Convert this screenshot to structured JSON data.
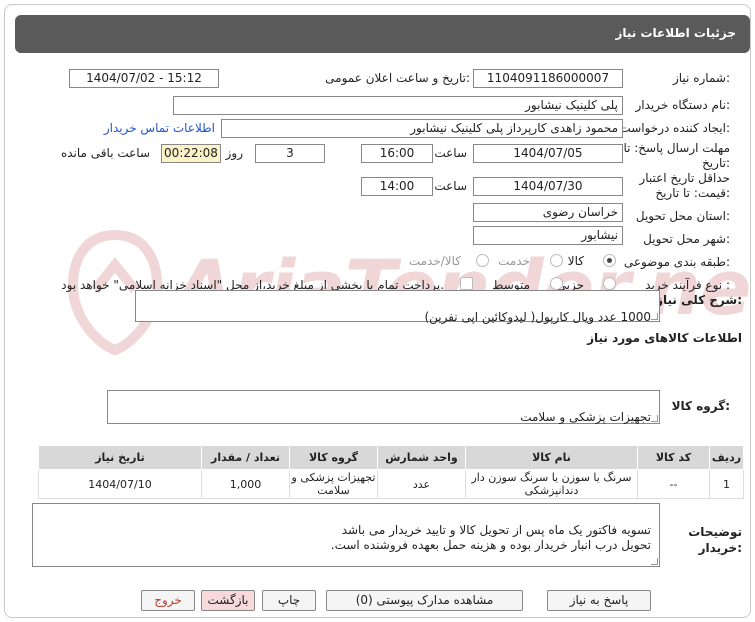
{
  "header": {
    "title": "جزئیات اطلاعات نیاز"
  },
  "fields": {
    "need_number_label": "شماره نیاز:",
    "need_number": "1104091186000007",
    "announce_label": "تاریخ و ساعت اعلان عمومی:",
    "announce_value": "1404/07/02 - 15:12",
    "buyer_org_label": "نام دستگاه خریدار:",
    "buyer_org": "پلی کلینیک نیشابور",
    "creator_label": "ایجاد کننده درخواست:",
    "creator": "محمود زاهدی کارپرداز پلی کلینیک نیشابور",
    "contact_link": "اطلاعات تماس خریدار",
    "deadline_label": "مهلت ارسال پاسخ: تا تاریخ:",
    "deadline_date": "1404/07/05",
    "time_label": "ساعت",
    "deadline_time": "16:00",
    "days_value": "3",
    "days_label": "روز و",
    "remaining_time": "00:22:08",
    "remaining_label": "ساعت باقی مانده",
    "price_validity_label": "حداقل تاریخ اعتبار قیمت: تا تاریخ:",
    "validity_date": "1404/07/30",
    "validity_time": "14:00",
    "province_label": "استان محل تحویل:",
    "province": "خراسان رضوی",
    "city_label": "شهر محل تحویل:",
    "city": "نیشابور",
    "category_label": "طبقه بندی موضوعی:",
    "category_options": [
      "کالا",
      "خدمت",
      "کالا/خدمت"
    ],
    "process_label": "نوع فرآیند خرید :",
    "process_options": [
      "جزیی",
      "متوسط"
    ],
    "treasury_note": "پرداخت تمام یا بخشی از مبلغ خرید،از محل \"اسناد خزانه اسلامی\" خواهد بود.",
    "summary_label": "شرح کلی نیاز:",
    "summary": "1000 عدد ویال کارپول( لیدوکائین اپی نفرین)",
    "goods_info_label": "اطلاعات کالاهای مورد نیاز",
    "goods_group_label": "گروه کالا:",
    "goods_group": "تجهیزات پزشکی و سلامت",
    "buyer_notes_label": "توضیحات خریدار:",
    "buyer_notes": "تسویه فاکتور یک ماه پس از تحویل کالا و تایید خریدار می باشد\nتحویل درب انبار خریدار بوده و هزینه حمل بعهده فروشنده است."
  },
  "table": {
    "headers": [
      "ردیف",
      "کد کالا",
      "نام کالا",
      "واحد شمارش",
      "گروه کالا",
      "تعداد / مقدار",
      "تاریخ نیاز"
    ],
    "rows": [
      [
        "1",
        "--",
        "سرنگ یا سوزن یا سرنگ سوزن دار دندانپزشکی",
        "عدد",
        "تجهیزات پزشکی و سلامت",
        "1,000",
        "1404/07/10"
      ]
    ]
  },
  "buttons": {
    "reply": "پاسخ به نیاز",
    "attachments": "مشاهده مدارک پیوستی (0)",
    "print": "چاپ",
    "back": "بازگشت",
    "exit": "خروج"
  },
  "watermark": "AriaTender.net",
  "colors": {
    "header_bg": "#5a5a5a",
    "remaining_bg": "#fbf3c7",
    "link": "#2255cc",
    "exit_text": "#c0392b"
  }
}
